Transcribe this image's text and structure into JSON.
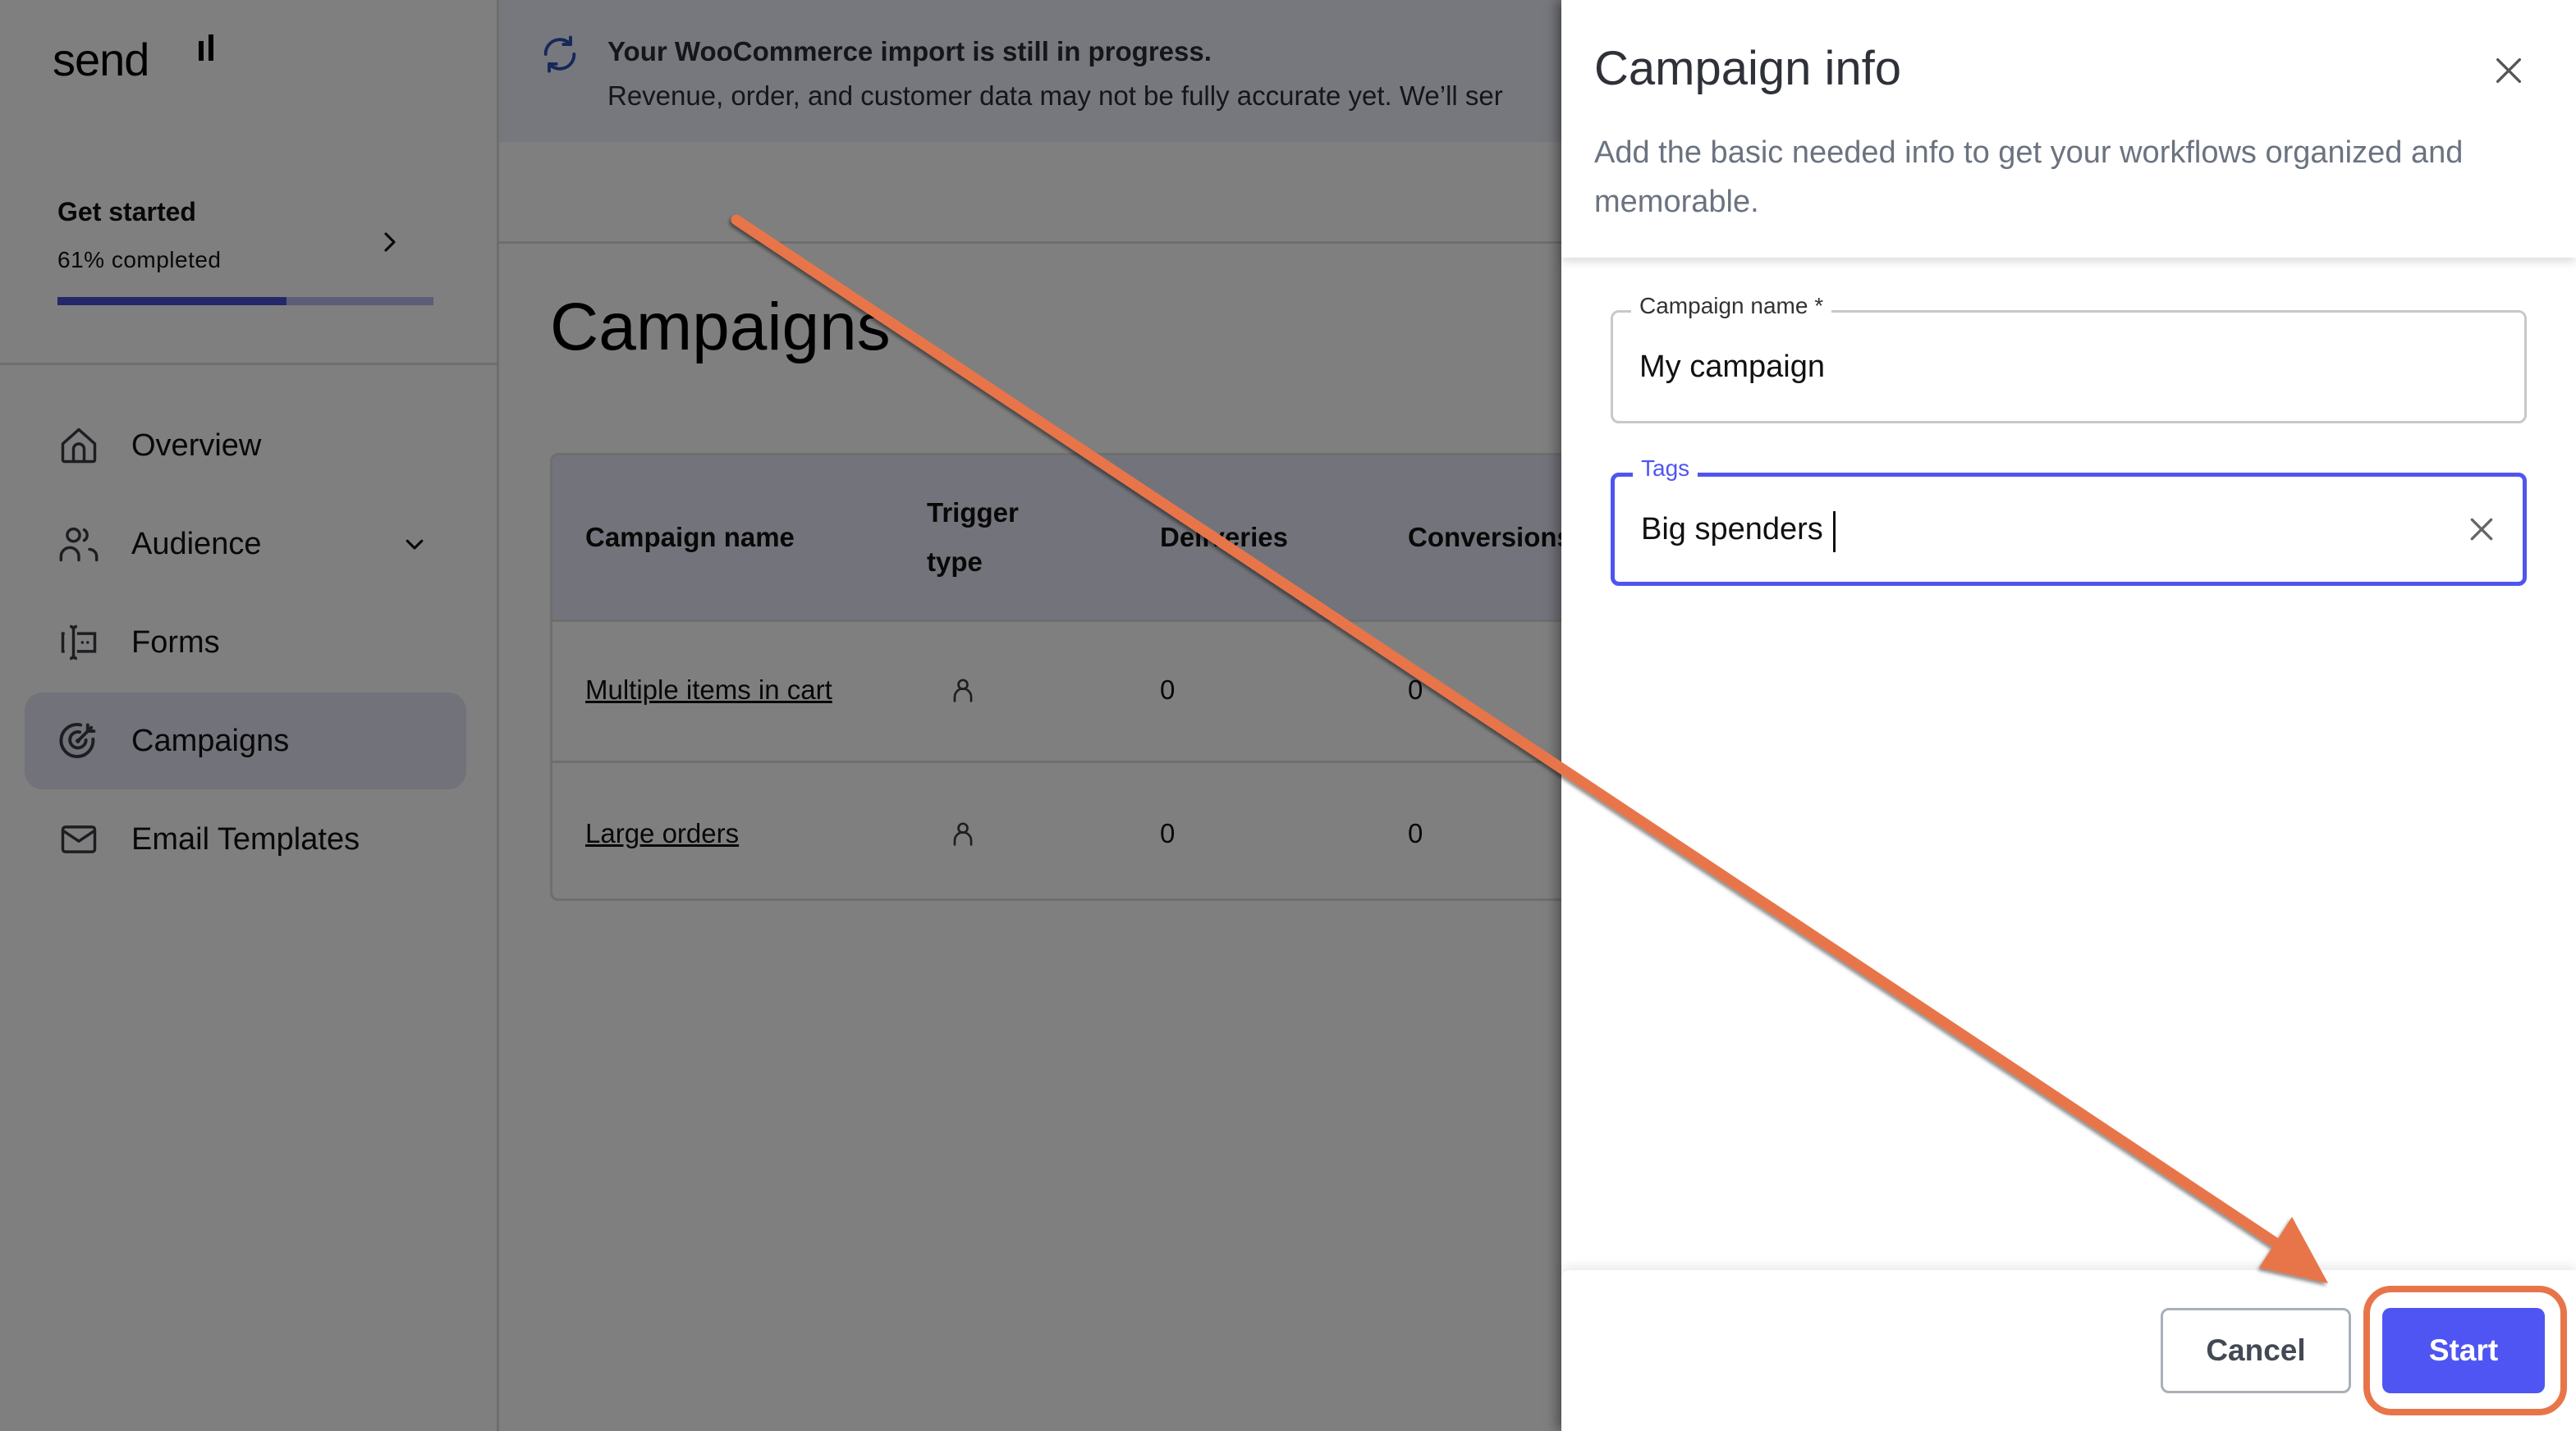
{
  "app": {
    "logo": "send",
    "get_started": {
      "title": "Get started",
      "progress_text": "61% completed",
      "progress_percent": 61
    },
    "sidebar": {
      "items": [
        {
          "label": "Overview",
          "icon": "home-icon",
          "active": false
        },
        {
          "label": "Audience",
          "icon": "users-icon",
          "active": false,
          "expandable": true
        },
        {
          "label": "Forms",
          "icon": "form-icon",
          "active": false
        },
        {
          "label": "Campaigns",
          "icon": "target-icon",
          "active": true
        },
        {
          "label": "Email Templates",
          "icon": "mail-icon",
          "active": false
        }
      ]
    },
    "banner": {
      "icon": "sync-icon",
      "title": "Your WooCommerce import is still in progress.",
      "text": "Revenue, order, and customer data may not be fully accurate yet. We’ll ser"
    },
    "page_title": "Campaigns",
    "table": {
      "columns": [
        "Campaign name",
        "Trigger type",
        "Deliveries",
        "Conversions"
      ],
      "column_lines": {
        "trigger_1": "Trigger",
        "trigger_2": "type",
        "deliveries": "Deliveries"
      },
      "rows": [
        {
          "name": "Multiple items in cart",
          "trigger_icon": "person-icon",
          "deliveries": "0",
          "conversions": "0"
        },
        {
          "name": "Large orders",
          "trigger_icon": "person-icon",
          "deliveries": "0",
          "conversions": "0"
        }
      ]
    }
  },
  "drawer": {
    "title": "Campaign info",
    "subtitle": "Add the basic needed info to get your workflows organized and memorable.",
    "fields": {
      "campaign_name": {
        "label": "Campaign name *",
        "value": "My campaign"
      },
      "tags": {
        "label": "Tags",
        "value": "Big spenders"
      }
    },
    "cancel_label": "Cancel",
    "start_label": "Start"
  },
  "colors": {
    "accent": "#4f55f2",
    "annotation": "#e8754a",
    "progress_fill": "#4a4fd6"
  }
}
